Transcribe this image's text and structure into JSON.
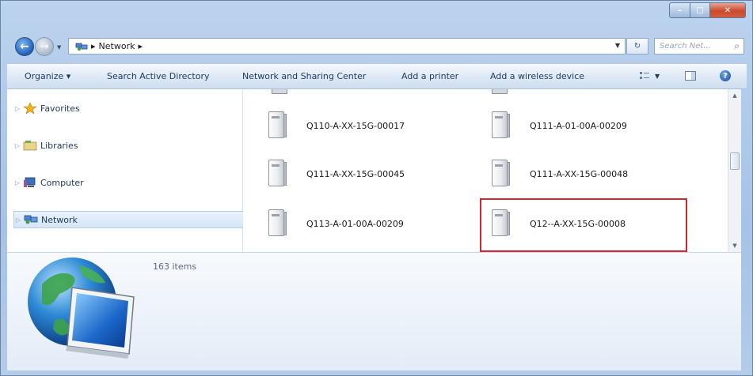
{
  "window": {
    "caption_buttons": {
      "minimize": "–",
      "maximize": "□",
      "close": "✕"
    }
  },
  "address_bar": {
    "path": "Network",
    "separator_before": "▸",
    "separator_after": "▸",
    "search_placeholder": "Search Net...",
    "icons": {
      "back": "back-arrow-icon",
      "forward": "forward-arrow-icon",
      "refresh": "refresh-icon",
      "search": "magnifier-icon"
    }
  },
  "toolbar": {
    "organize": "Organize ▾",
    "search_ad": "Search Active Directory",
    "network_center": "Network and Sharing Center",
    "add_printer": "Add a printer",
    "add_wireless": "Add a wireless device",
    "help": "?"
  },
  "nav_pane": {
    "items": [
      {
        "label": "Favorites",
        "icon": "star-icon"
      },
      {
        "label": "Libraries",
        "icon": "libraries-icon"
      },
      {
        "label": "Computer",
        "icon": "computer-icon"
      },
      {
        "label": "Network",
        "icon": "network-icon",
        "selected": true
      }
    ]
  },
  "content": {
    "items": [
      {
        "label": "Q110-A-XX-15G-00017",
        "col": 0,
        "row": 0
      },
      {
        "label": "Q111-A-01-00A-00209",
        "col": 1,
        "row": 0
      },
      {
        "label": "Q111-A-XX-15G-00045",
        "col": 0,
        "row": 1
      },
      {
        "label": "Q111-A-XX-15G-00048",
        "col": 1,
        "row": 1
      },
      {
        "label": "Q113-A-01-00A-00209",
        "col": 0,
        "row": 2
      },
      {
        "label": "Q12--A-XX-15G-00008",
        "col": 1,
        "row": 2,
        "highlighted": true
      }
    ]
  },
  "details_pane": {
    "item_count": "163 items"
  },
  "colors": {
    "highlight": "#d6252c",
    "chrome": "#b4cbe9"
  }
}
